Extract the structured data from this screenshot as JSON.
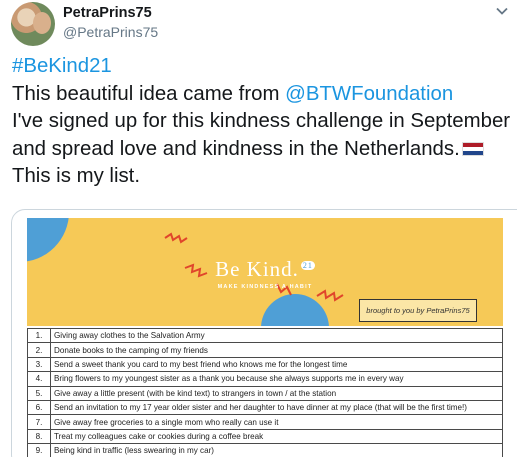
{
  "author": {
    "display_name": "PetraPrins75",
    "handle": "@PetraPrins75"
  },
  "icons": [
    "avatar",
    "chevron-down-icon",
    "netherlands-flag-icon"
  ],
  "tweet": {
    "hashtag": "#BeKind21",
    "line1_prefix": "This beautiful idea came from ",
    "mention": "@BTWFoundation",
    "line2": "I've signed up for this kindness challenge in September and spread love and kindness in the Netherlands.",
    "line3": " This is my list."
  },
  "card": {
    "banner_title": "Be Kind.",
    "banner_badge": "21",
    "banner_subtitle": "MAKE KINDNESS A HABIT",
    "credit": "brought to you by PetraPrins75",
    "banner_color": "#f6c957",
    "items": [
      {
        "num": "1.",
        "text": "Giving away clothes to the Salvation Army"
      },
      {
        "num": "2.",
        "text": "Donate books to the camping of my friends"
      },
      {
        "num": "3.",
        "text": "Send a sweet thank you card to my best friend who knows me for the longest time"
      },
      {
        "num": "4.",
        "text": "Bring flowers to my youngest sister as a thank you because she always supports me in every way"
      },
      {
        "num": "5.",
        "text": "Give away a little present (with be kind text) to strangers in town / at the station"
      },
      {
        "num": "6.",
        "text": "Send an invitation to my 17 year older sister and her daughter to have dinner at my place  (that will be the first time!)"
      },
      {
        "num": "7.",
        "text": "Give away free groceries to a single mom who really can use it"
      },
      {
        "num": "8.",
        "text": "Treat my colleagues cake or cookies during a coffee break"
      },
      {
        "num": "9.",
        "text": "Being kind in traffic (less swearing in my car)"
      }
    ]
  }
}
